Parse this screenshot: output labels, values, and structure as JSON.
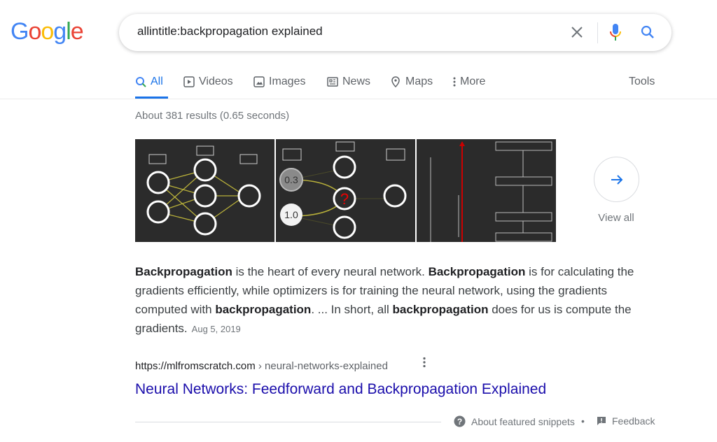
{
  "logo": {
    "text": "Google",
    "colors": [
      "#4285f4",
      "#ea4335",
      "#fbbc05",
      "#4285f4",
      "#34a853",
      "#ea4335"
    ]
  },
  "search": {
    "query": "allintitle:backpropagation explained"
  },
  "tabs": [
    {
      "label": "All",
      "icon": "search-icon",
      "active": true
    },
    {
      "label": "Videos",
      "icon": "play-icon"
    },
    {
      "label": "Images",
      "icon": "image-icon"
    },
    {
      "label": "News",
      "icon": "news-icon"
    },
    {
      "label": "Maps",
      "icon": "map-pin-icon"
    },
    {
      "label": "More",
      "icon": "more-vert-icon"
    }
  ],
  "tools": "Tools",
  "stats": "About 381 results (0.65 seconds)",
  "images": {
    "img2_values": [
      "0.3",
      "1.0",
      "?"
    ],
    "view_all": "View all"
  },
  "snippet": {
    "parts": [
      {
        "b": "Backpropagation"
      },
      {
        "t": " is the heart of every neural network. "
      },
      {
        "b": "Backpropagation"
      },
      {
        "t": " is for calculating the gradients efficiently, while optimizers is for training the neural network, using the gradients computed with "
      },
      {
        "b": "backpropagation"
      },
      {
        "t": ". ... In short, all "
      },
      {
        "b": "backpropagation"
      },
      {
        "t": " does for us is compute the gradients."
      }
    ],
    "date": "Aug 5, 2019"
  },
  "result": {
    "url_domain": "https://mlfromscratch.com",
    "url_path": " › neural-networks-explained",
    "title": "Neural Networks: Feedforward and Backpropagation Explained"
  },
  "footer": {
    "about": "About featured snippets",
    "sep": "•",
    "feedback": "Feedback"
  },
  "colors": {
    "link": "#1a0dab",
    "accent": "#1a73e8"
  }
}
